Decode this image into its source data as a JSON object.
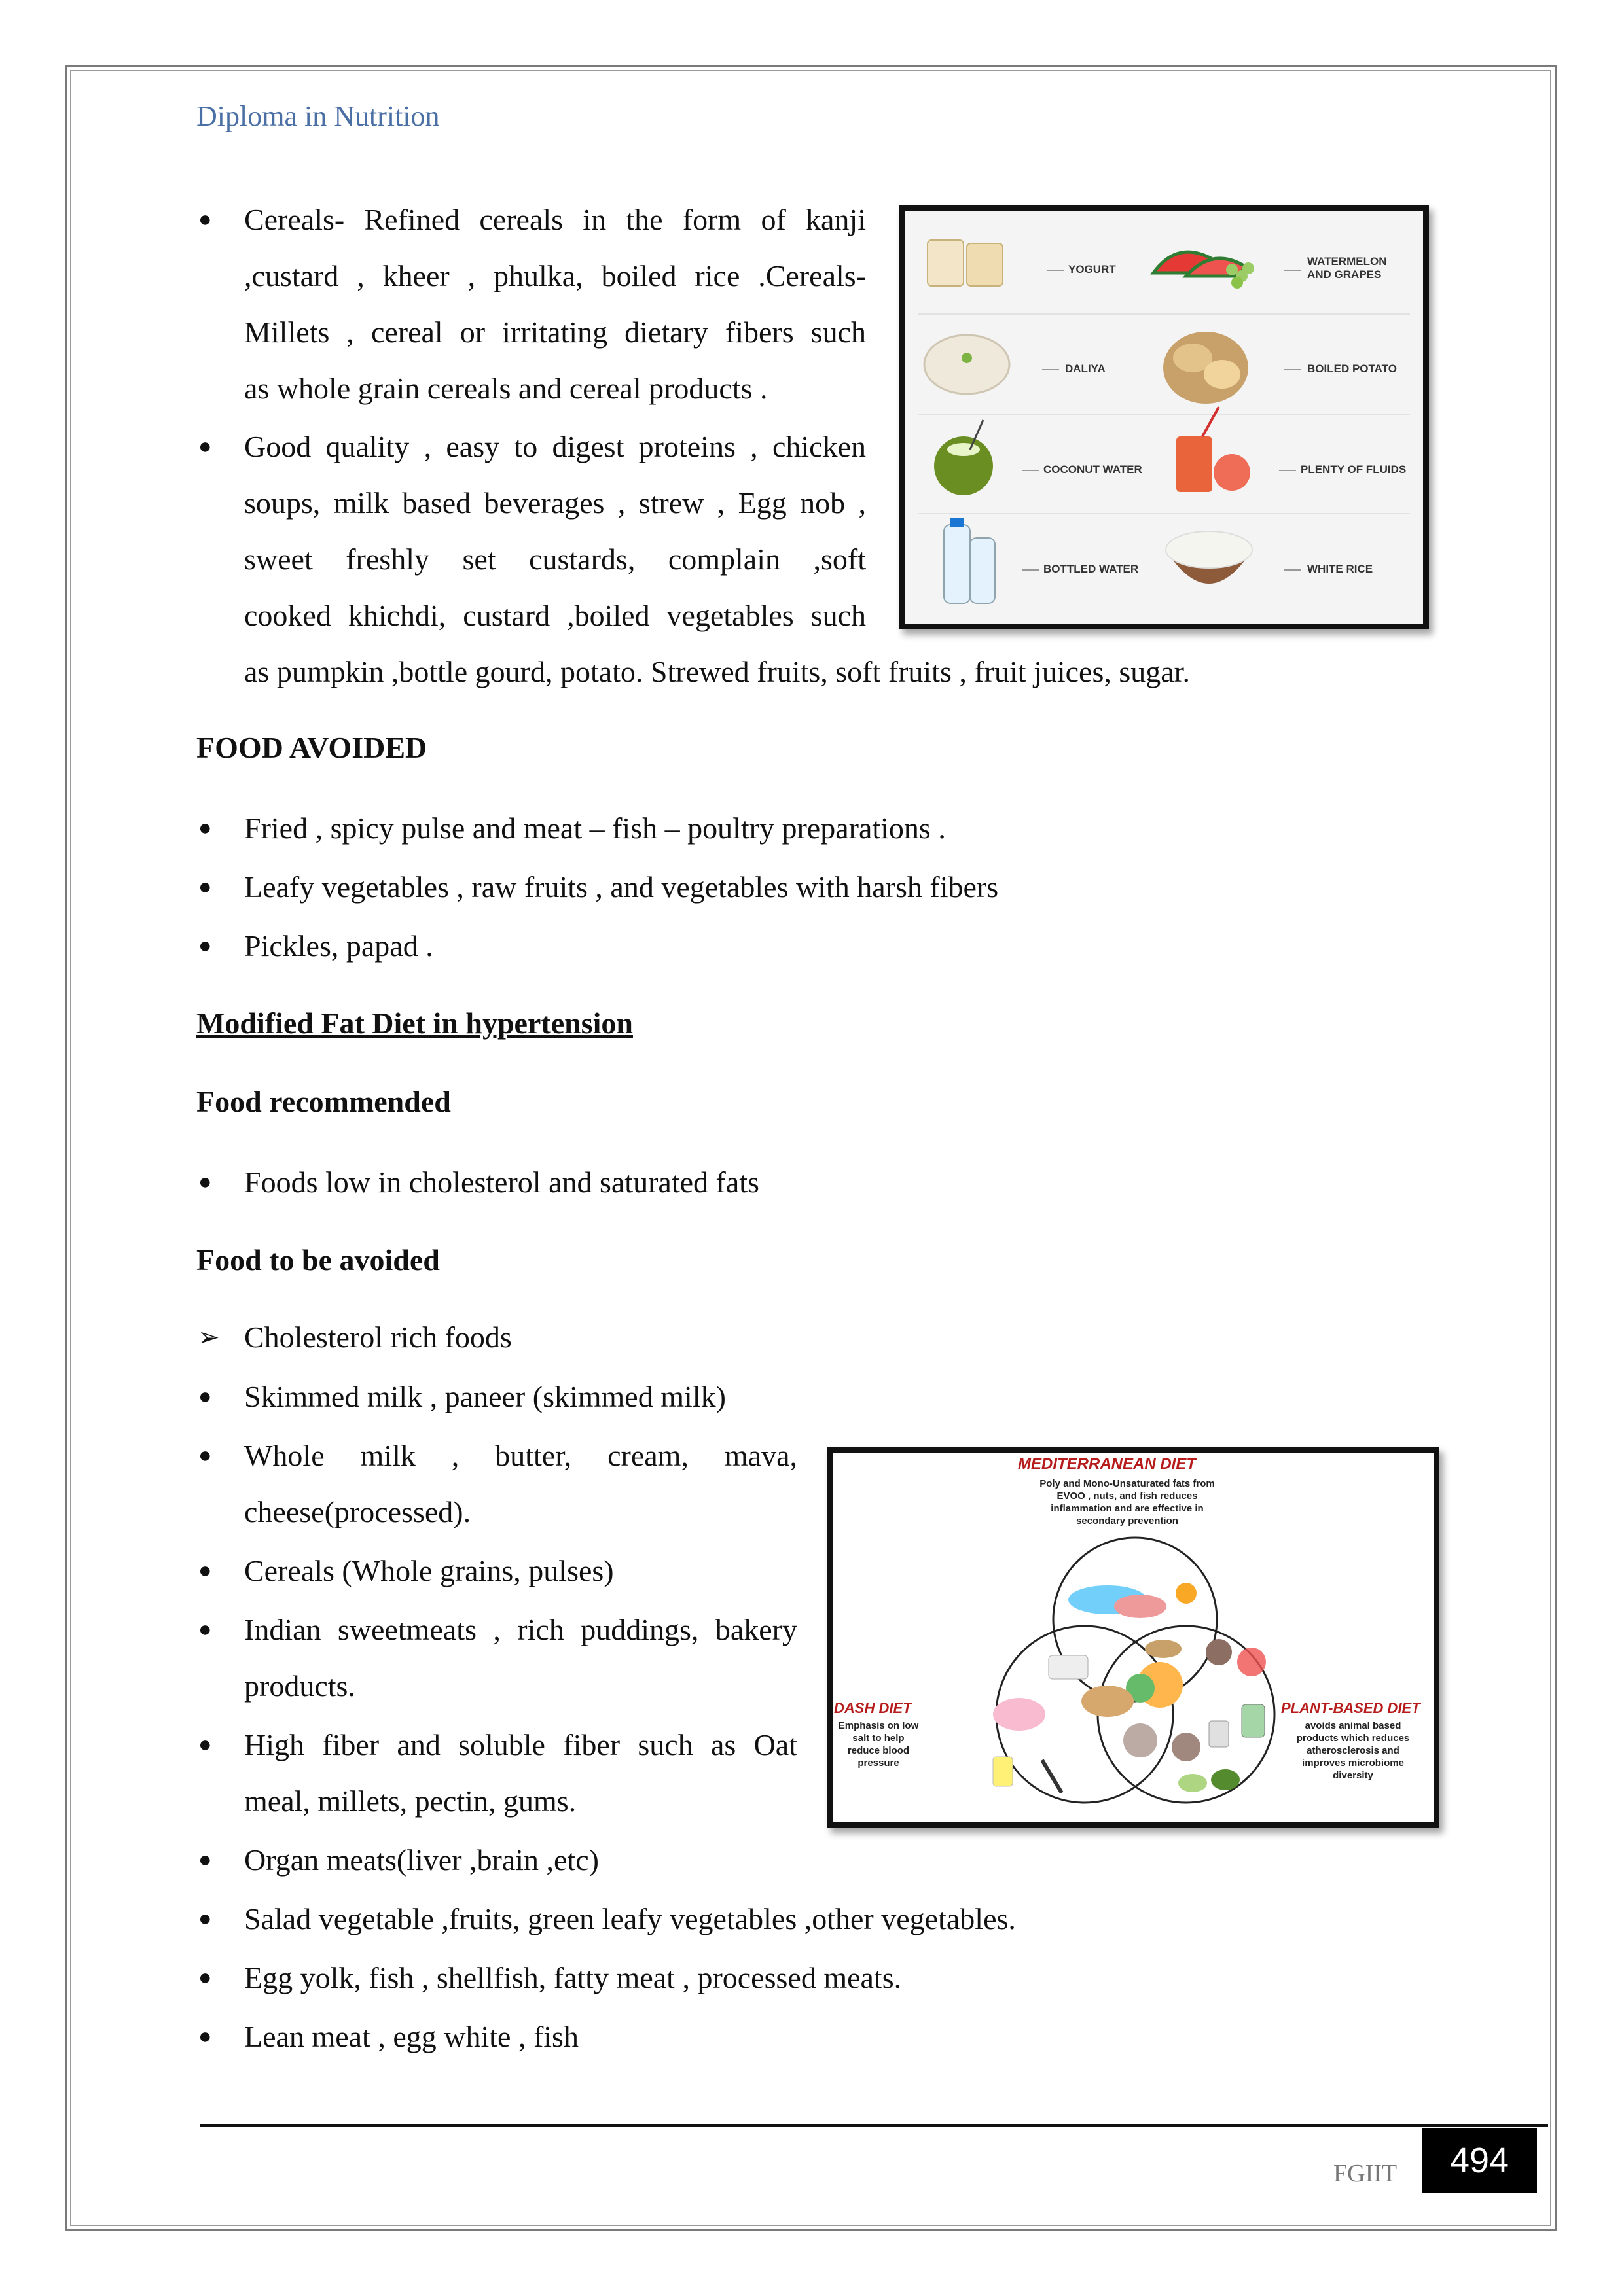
{
  "header": {
    "title": "Diploma in Nutrition"
  },
  "allowed_foods": {
    "items": [
      {
        "lines": [
          "Cereals- Refined cereals in the form of kanji",
          ",custard , kheer , phulka, boiled rice .Cereals-",
          "Millets , cereal or irritating dietary fibers such",
          "as whole grain cereals and cereal products ."
        ]
      },
      {
        "lines": [
          "Good quality , easy to digest proteins , chicken",
          "soups, milk based beverages , strew , Egg nob ,",
          "sweet freshly set custards, complain ,soft",
          "cooked khichdi, custard ,boiled vegetables such",
          "as pumpkin ,bottle gourd, potato. Strewed fruits, soft fruits , fruit juices, sugar."
        ]
      }
    ]
  },
  "food_figure": {
    "labels": [
      "YOGURT",
      "WATERMELON AND GRAPES",
      "DALIYA",
      "BOILED POTATO",
      "COCONUT WATER",
      "PLENTY OF FLUIDS",
      "BOTTLED WATER",
      "WHITE RICE"
    ],
    "colors": {
      "yogurt": "#f3e6c8",
      "watermelon": "#e53935",
      "grapes": "#9ccc65",
      "daliya": "#efe9dc",
      "potato": "#c8a16a",
      "coconut": "#6b8e23",
      "juice": "#e64a19",
      "bottle": "#e3f2fd",
      "rice": "#f5f5f0",
      "bowl": "#8d5a3a"
    }
  },
  "food_avoided": {
    "heading": "FOOD AVOIDED",
    "items": [
      "Fried , spicy pulse and meat – fish – poultry preparations .",
      "Leafy vegetables , raw fruits , and vegetables with harsh fibers",
      "Pickles, papad ."
    ]
  },
  "modified_fat": {
    "title": "Modified Fat Diet in hypertension",
    "recommended_heading": "Food recommended",
    "recommended_items": [
      "Foods low in cholesterol and saturated fats"
    ],
    "avoid_heading": "Food to be avoided",
    "arrow_item": "Cholesterol rich foods",
    "avoid_items": [
      {
        "lines": [
          "Skimmed milk , paneer (skimmed milk)"
        ]
      },
      {
        "lines": [
          "Whole milk , butter, cream, mava,",
          "cheese(processed)."
        ]
      },
      {
        "lines": [
          "Cereals (Whole grains, pulses)"
        ]
      },
      {
        "lines": [
          "Indian sweetmeats , rich puddings, bakery",
          "products."
        ]
      },
      {
        "lines": [
          "High fiber and soluble fiber such as Oat",
          "meal, millets, pectin, gums."
        ]
      },
      {
        "lines": [
          "Organ meats(liver ,brain ,etc)"
        ]
      },
      {
        "lines": [
          "Salad vegetable ,fruits, green leafy vegetables ,other vegetables."
        ]
      },
      {
        "lines": [
          "Egg yolk, fish , shellfish, fatty meat , processed meats."
        ]
      },
      {
        "lines": [
          "Lean meat , egg white , fish"
        ]
      }
    ]
  },
  "diet_figure": {
    "mediterranean": {
      "title": "MEDITERRANEAN DIET",
      "text": [
        "Poly and Mono-Unsaturated fats from",
        "EVOO , nuts, and fish reduces",
        "inflammation and are effective in",
        "secondary prevention"
      ]
    },
    "dash": {
      "title": "DASH DIET",
      "text": [
        "Emphasis on low",
        "salt to help",
        "reduce blood",
        "pressure"
      ]
    },
    "plant": {
      "title": "PLANT-BASED DIET",
      "text": [
        "avoids animal based",
        "products which reduces",
        "atherosclerosis and",
        "improves microbiome",
        "diversity"
      ]
    },
    "title_color": "#b71c1c"
  },
  "footer": {
    "org": "FGIIT",
    "page": "494"
  }
}
